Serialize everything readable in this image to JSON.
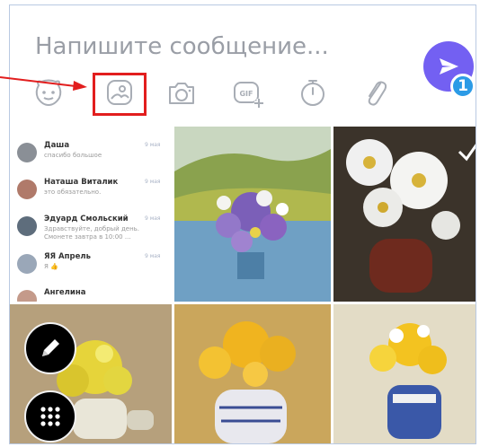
{
  "compose": {
    "placeholder": "Напишите сообщение..."
  },
  "send": {
    "badge_count": "1"
  },
  "toolbar": {
    "icons": [
      "sticker-icon",
      "gallery-icon",
      "camera-icon",
      "gif-icon",
      "timer-icon",
      "attachment-icon"
    ]
  },
  "chat_preview": {
    "rows": [
      {
        "name": "Даша",
        "snippet": "спасибо большое",
        "time": "9 мая"
      },
      {
        "name": "Наташа Виталик",
        "snippet": "это обязательно.",
        "time": "9 мая"
      },
      {
        "name": "Эдуард Смольский",
        "snippet": "Здравствуйте, добрый день.\nСмонете завтра в 10:00 ...",
        "time": "9 мая"
      },
      {
        "name": "ЯЯ Апрель",
        "snippet": "Я 👍",
        "time": "9 мая"
      },
      {
        "name": "Ангелина",
        "snippet": "",
        "time": ""
      }
    ]
  },
  "colors": {
    "accent": "#7360f2",
    "badge": "#2c9be6",
    "highlight": "#e21e1e"
  }
}
